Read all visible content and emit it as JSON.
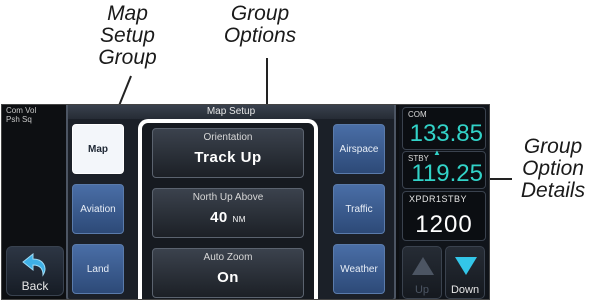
{
  "callouts": {
    "map_setup_group": "Map\nSetup\nGroup",
    "group_options": "Group\nOptions",
    "group_option_details": "Group\nOption\nDetails"
  },
  "device": {
    "com_vol": "Com Vol\nPsh Sq",
    "back_label": "Back",
    "window_title": "Map Setup",
    "tabs": {
      "map": "Map",
      "aviation": "Aviation",
      "land": "Land",
      "airspace": "Airspace",
      "traffic": "Traffic",
      "weather": "Weather"
    },
    "options": {
      "orientation": {
        "label": "Orientation",
        "value": "Track Up"
      },
      "north_up_above": {
        "label": "North Up Above",
        "value": "40",
        "unit": "NM"
      },
      "auto_zoom": {
        "label": "Auto Zoom",
        "value": "On"
      }
    },
    "radio": {
      "com_label": "COM",
      "com_freq": "133.85",
      "stby_label": "STBY",
      "stby_freq": "119.25",
      "xpdr_status": "XPDR1STBY",
      "xpdr_code": "1200",
      "up_label": "Up",
      "down_label": "Down"
    },
    "colors": {
      "frequency": "#32d3c8",
      "selected_tab": "#f3f6fa",
      "tab": "#3b5d93",
      "down_arrow": "#33c6e8"
    }
  }
}
